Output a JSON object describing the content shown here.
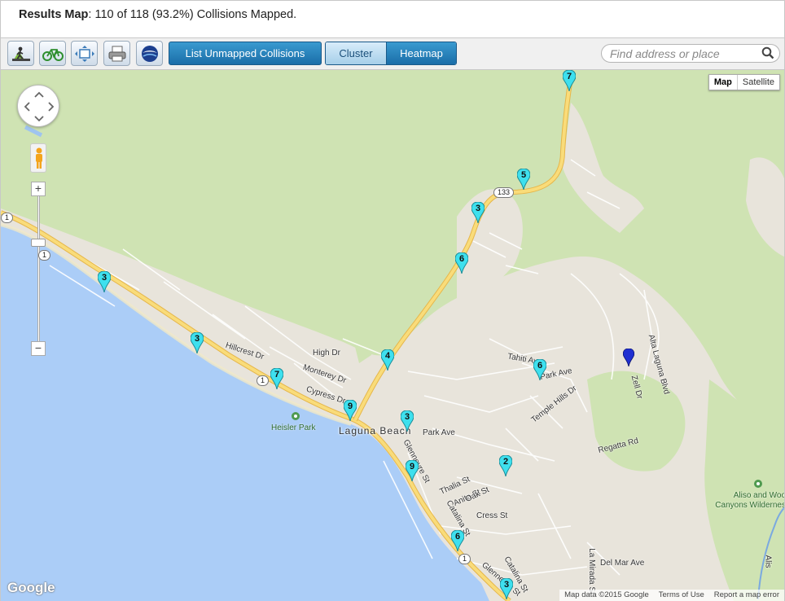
{
  "header": {
    "title": "Results Map",
    "summary": ": 110 of 118 (93.2%) Collisions Mapped."
  },
  "toolbar": {
    "list_unmapped_label": "List Unmapped Collisions",
    "cluster_label": "Cluster",
    "heatmap_label": "Heatmap",
    "search_placeholder": "Find address or place"
  },
  "map_type": {
    "map": "Map",
    "satellite": "Satellite"
  },
  "markers": [
    "7",
    "5",
    "3",
    "6",
    "3",
    "3",
    "7",
    "4",
    "9",
    "3",
    "9",
    "6",
    "2",
    "6",
    "3"
  ],
  "labels": {
    "hillcrest": "Hillcrest Dr",
    "high": "High Dr",
    "monterey": "Monterey Dr",
    "cypress": "Cypress Dr",
    "heisler": "Heisler Park",
    "laguna": "Laguna Beach",
    "park_ave1": "Park Ave",
    "park_ave2": "Park Ave",
    "tahiti": "Tahiti Ave",
    "temple": "Temple Hills Dr",
    "alta": "Alta Laguna Blvd",
    "zell": "Zell Dr",
    "regatta": "Regatta Rd",
    "glenneyre": "Glenneyre St",
    "glenneyre2": "Glenneyre St",
    "thalia": "Thalia St",
    "anita": "Anita St",
    "oak": "Oak St",
    "cress": "Cress St",
    "catalina": "Catalina St",
    "catalina2": "Catalina St",
    "lamirada": "La Mirada St",
    "delmar": "Del Mar Ave",
    "aliso1": "Aliso and Woo",
    "aliso2": "Canyons Wildernes",
    "alis": "Alis"
  },
  "shields": {
    "r1a": "1",
    "r1b": "1",
    "r1c": "1",
    "r1d": "1",
    "r133": "133"
  },
  "footer": {
    "google": "Google",
    "map_data": "Map data ©2015 Google",
    "terms": "Terms of Use",
    "report": "Report a map error"
  },
  "colors": {
    "marker": "#3ee0ee",
    "selected_marker": "#1f2fd1",
    "water": "#abcdf7",
    "land": "#e9e5dc",
    "green": "#cde4b0",
    "highway": "#f6cf5d"
  }
}
